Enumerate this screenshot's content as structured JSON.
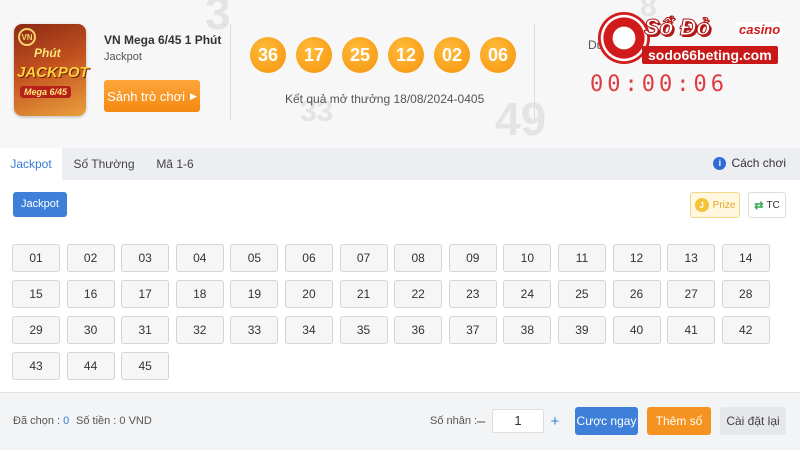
{
  "game": {
    "logo_words": [
      "VN",
      "Phút",
      "JACKPOT",
      "Mega 6/45"
    ],
    "title": "VN Mega 6/45 1 Phút",
    "subtitle": "Jackpot",
    "lobby_button": "Sảnh trò chơi"
  },
  "result": {
    "balls": [
      "36",
      "17",
      "25",
      "12",
      "02",
      "06"
    ],
    "text": "Kết quả mở thưởng 18/08/2024-0405",
    "ball_color": "#f5930e"
  },
  "countdown": {
    "label": "Du",
    "value": "00:00:06",
    "color": "#e0393e"
  },
  "brand": {
    "name": "Sổ Đỏ",
    "tag": "casino",
    "domain": "sodo66beting.com"
  },
  "tabs": [
    {
      "label": "Jackpot",
      "active": true
    },
    {
      "label": "Số Thường",
      "active": false
    },
    {
      "label": "Mã 1-6",
      "active": false
    }
  ],
  "guide_label": "Cách chơi",
  "mode_pill": "Jackpot",
  "prize_label": "Prize",
  "tc_label": "TC",
  "numbers": [
    "01",
    "02",
    "03",
    "04",
    "05",
    "06",
    "07",
    "08",
    "09",
    "10",
    "11",
    "12",
    "13",
    "14",
    "15",
    "16",
    "17",
    "18",
    "19",
    "20",
    "21",
    "22",
    "23",
    "24",
    "25",
    "26",
    "27",
    "28",
    "29",
    "30",
    "31",
    "32",
    "33",
    "34",
    "35",
    "36",
    "37",
    "38",
    "39",
    "40",
    "41",
    "42",
    "43",
    "44",
    "45"
  ],
  "footer": {
    "selected_label": "Đã chọn : ",
    "selected_value": "0",
    "amount_label": "Số tiền : ",
    "amount_value": "0 VND",
    "multiplier_label": "Số nhân :",
    "multiplier_value": "1",
    "bet_button": "Cược ngay",
    "add_button": "Thêm số",
    "reset_button": "Cài đặt lại"
  },
  "colors": {
    "accent_blue": "#3d7fd9",
    "accent_orange": "#f69320",
    "brand_red": "#c81818"
  }
}
